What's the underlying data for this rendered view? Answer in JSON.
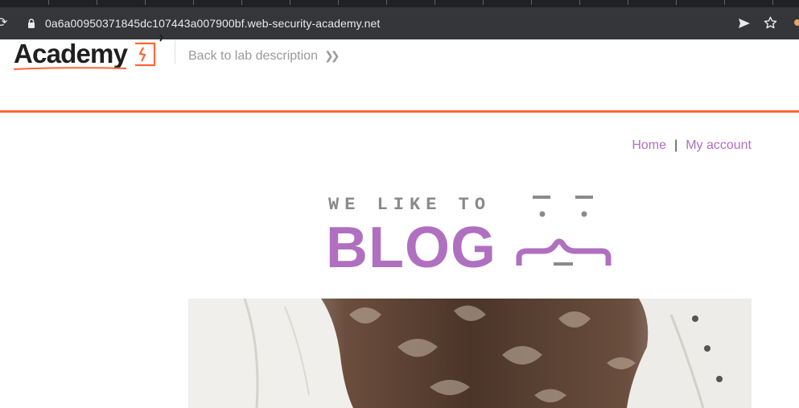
{
  "browser": {
    "url": "0a6a00950371845dc107443a007900bf.web-security-academy.net"
  },
  "lab_header": {
    "logo_text": "Academy",
    "back_link": "Back to lab description"
  },
  "nav": {
    "home": "Home",
    "separator": "|",
    "account": "My account"
  },
  "banner": {
    "tagline": "WE LIKE TO",
    "title": "BLOG"
  },
  "colors": {
    "accent_orange": "#ff6633",
    "link_purple": "#b070c0",
    "chrome_bg": "#35363a"
  }
}
